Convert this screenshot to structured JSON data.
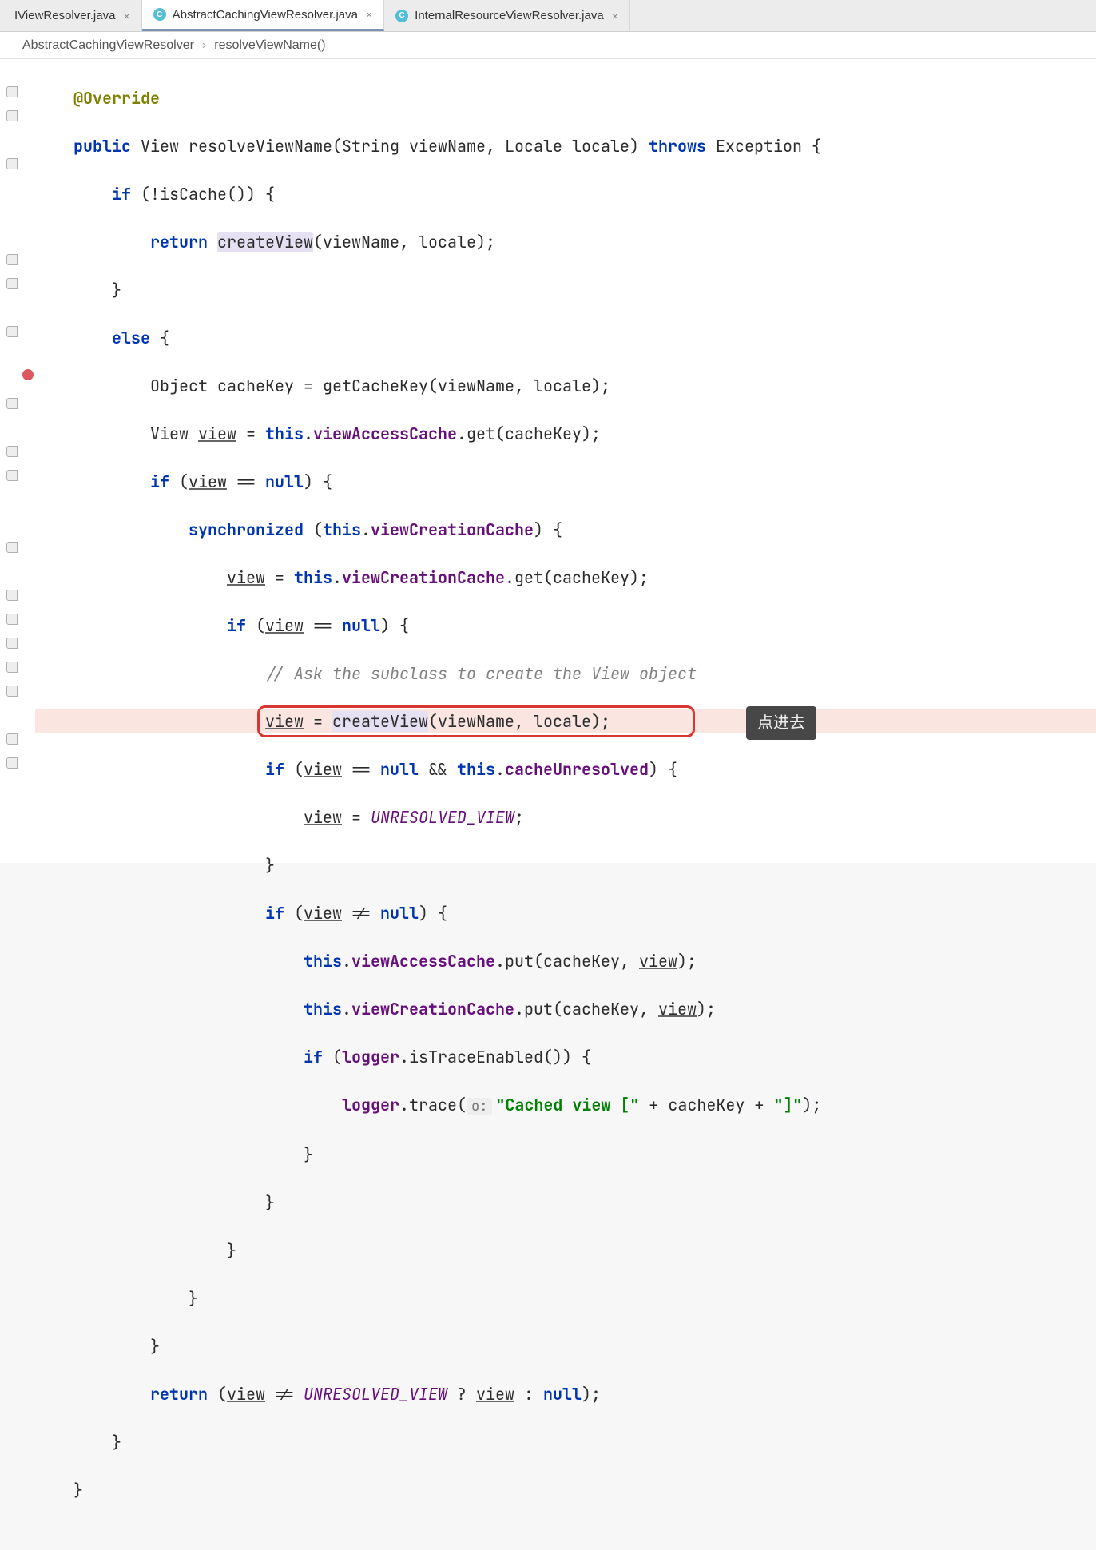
{
  "tabs": [
    {
      "name": "IViewResolver.java",
      "icon": "",
      "active": false
    },
    {
      "name": "AbstractCachingViewResolver.java",
      "icon": "C",
      "active": true
    },
    {
      "name": "InternalResourceViewResolver.java",
      "icon": "C",
      "active": false
    }
  ],
  "breadcrumb": {
    "class": "AbstractCachingViewResolver",
    "method": "resolveViewName()"
  },
  "code": {
    "override": "@Override",
    "public": "public",
    "type_view": "View",
    "method_name": "resolveViewName",
    "param1_type": "String",
    "param1_name": "viewName",
    "param2_type": "Locale",
    "param2_name": "locale",
    "throws": "throws",
    "exception": "Exception",
    "if": "if",
    "else": "else",
    "return": "return",
    "isCache": "isCache",
    "createView": "createView",
    "object": "Object",
    "cacheKey": "cacheKey",
    "getCacheKey": "getCacheKey",
    "view": "view",
    "this": "this",
    "viewAccessCache": "viewAccessCache",
    "viewCreationCache": "viewCreationCache",
    "get": "get",
    "put": "put",
    "null": "null",
    "synchronized": "synchronized",
    "comment_subclass": "// Ask the subclass to create the View object",
    "amp": "&&",
    "cacheUnresolved": "cacheUnresolved",
    "unresolved_view": "UNRESOLVED_VIEW",
    "neq": "!=",
    "logger": "logger",
    "isTraceEnabled": "isTraceEnabled",
    "trace": "trace",
    "inlay_o": "o:",
    "str1": "\"Cached view [\"",
    "str2": "\"]\"",
    "plus": "+",
    "q": "?",
    "colon": ":"
  },
  "annotation": {
    "label": "点进去"
  }
}
